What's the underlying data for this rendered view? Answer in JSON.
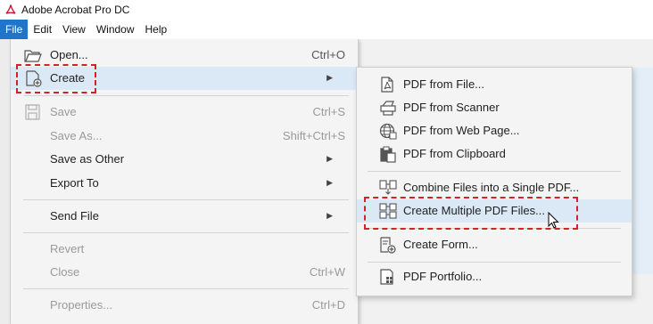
{
  "window": {
    "title": "Adobe Acrobat Pro DC"
  },
  "menubar": {
    "items": [
      {
        "label": "File",
        "active": true
      },
      {
        "label": "Edit",
        "active": false
      },
      {
        "label": "View",
        "active": false
      },
      {
        "label": "Window",
        "active": false
      },
      {
        "label": "Help",
        "active": false
      }
    ]
  },
  "file_menu": {
    "open": {
      "label": "Open...",
      "shortcut": "Ctrl+O",
      "icon": "folder-open-icon"
    },
    "create": {
      "label": "Create",
      "icon": "create-pdf-icon",
      "has_submenu": true
    },
    "save": {
      "label": "Save",
      "shortcut": "Ctrl+S",
      "icon": "floppy-disk-icon",
      "disabled": true
    },
    "save_as": {
      "label": "Save As...",
      "shortcut": "Shift+Ctrl+S",
      "disabled": true
    },
    "save_as_other": {
      "label": "Save as Other",
      "has_submenu": true
    },
    "export_to": {
      "label": "Export To",
      "has_submenu": true
    },
    "send_file": {
      "label": "Send File",
      "has_submenu": true
    },
    "revert": {
      "label": "Revert",
      "disabled": true
    },
    "close": {
      "label": "Close",
      "shortcut": "Ctrl+W",
      "disabled": true
    },
    "properties": {
      "label": "Properties...",
      "shortcut": "Ctrl+D",
      "disabled": true
    }
  },
  "create_submenu": {
    "pdf_from_file": {
      "label": "PDF from File...",
      "icon": "pdf-from-file-icon"
    },
    "pdf_from_scanner": {
      "label": "PDF from Scanner",
      "icon": "scanner-icon"
    },
    "pdf_from_web_page": {
      "label": "PDF from Web Page...",
      "icon": "globe-icon"
    },
    "pdf_from_clipboard": {
      "label": "PDF from Clipboard",
      "icon": "clipboard-icon"
    },
    "combine_files": {
      "label": "Combine Files into a Single PDF...",
      "icon": "combine-files-icon"
    },
    "create_multiple": {
      "label": "Create Multiple PDF Files...",
      "icon": "multiple-pdf-icon"
    },
    "create_form": {
      "label": "Create Form...",
      "icon": "form-icon"
    },
    "pdf_portfolio": {
      "label": "PDF Portfolio...",
      "icon": "portfolio-icon"
    }
  },
  "colors": {
    "highlight_dash": "#d2232a",
    "menu_active_blue": "#1f75c9",
    "hover_bg": "#dbe8f6",
    "acrobat_red": "#c8102e"
  }
}
